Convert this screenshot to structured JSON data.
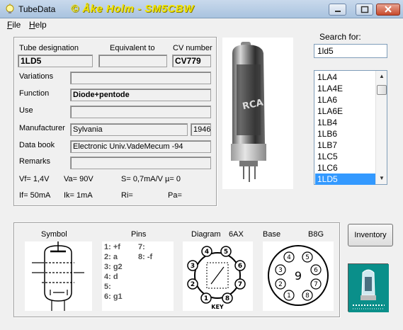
{
  "window": {
    "title": "TubeData",
    "banner": "© Åke Holm - SM5CBW"
  },
  "menu": [
    {
      "label": "File",
      "mnemonic": "F",
      "rest": "ile"
    },
    {
      "label": "Help",
      "mnemonic": "H",
      "rest": "elp"
    }
  ],
  "tube": {
    "designation_label": "Tube designation",
    "designation": "1LD5",
    "equivalent_label": "Equivalent to",
    "equivalent": "",
    "cv_label": "CV number",
    "cv": "CV779",
    "variations_label": "Variations",
    "variations": "",
    "function_label": "Function",
    "function": "Diode+pentode",
    "use_label": "Use",
    "use": "",
    "manufacturer_label": "Manufacturer",
    "manufacturer": "Sylvania",
    "year": "1946",
    "databook_label": "Data book",
    "databook": "Electronic Univ.VadeMecum -94",
    "remarks_label": "Remarks",
    "remarks": ""
  },
  "params": {
    "vf": "Vf= 1,4V",
    "va": "Va=  90V",
    "s": "S= 0,7mA/V",
    "mu": "µ=    0",
    "if": "If= 50mA",
    "ik": "Ik=   1mA",
    "ri": "Ri=",
    "pa": "Pa="
  },
  "search": {
    "label": "Search for:",
    "value": "1ld5"
  },
  "tube_list": [
    "1LA4",
    "1LA4E",
    "1LA6",
    "1LA6E",
    "1LB4",
    "1LB6",
    "1LB7",
    "1LC5",
    "1LC6",
    "1LD5"
  ],
  "selected_tube": "1LD5",
  "bottom": {
    "symbol_label": "Symbol",
    "pins_label": "Pins",
    "diagram_label": "Diagram",
    "diagram_code": "6AX",
    "base_label": "Base",
    "base_code": "B8G",
    "pins_left": [
      "1: +f",
      "2: a",
      "3: g2",
      "4: d",
      "5:",
      "6: g1"
    ],
    "pins_right": [
      "7:",
      "8: -f"
    ],
    "inventory_button": "Inventory",
    "key_text": "KEY"
  },
  "photo": {
    "brand_text": "RCA"
  },
  "colors": {
    "selection": "#3399ff",
    "banner": "#f3e600",
    "logo_bg": "#0a8f8a"
  }
}
